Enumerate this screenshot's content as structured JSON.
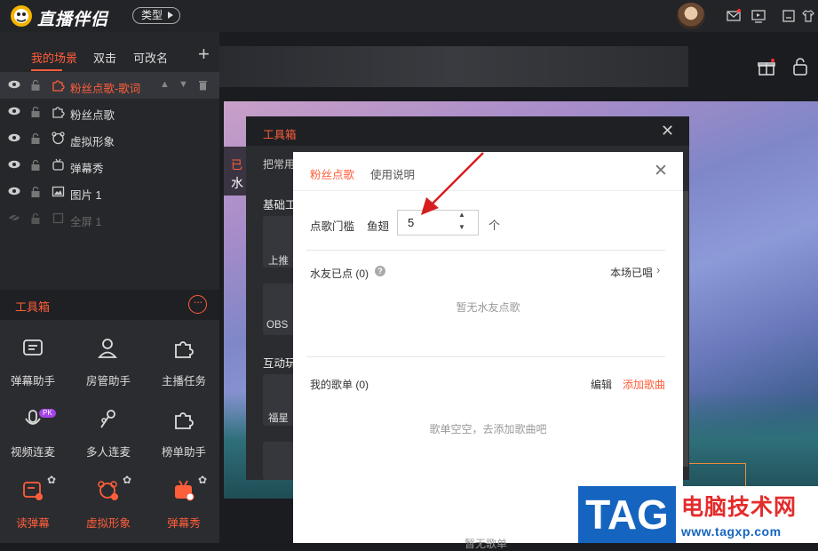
{
  "app": {
    "title": "直播伴侣",
    "type_button": "类型"
  },
  "scene_tabs": [
    {
      "label": "我的场景"
    },
    {
      "label": "双击"
    },
    {
      "label": "可改名"
    }
  ],
  "sources": [
    {
      "label": "粉丝点歌-歌词"
    },
    {
      "label": "粉丝点歌"
    },
    {
      "label": "虚拟形象"
    },
    {
      "label": "弹幕秀"
    },
    {
      "label": "图片 1"
    },
    {
      "label": "全屏 1"
    }
  ],
  "toolbox": {
    "title": "工具箱",
    "more_icon": "more-dots-icon",
    "tools": [
      {
        "label": "弹幕助手",
        "icon": "danmaku-helper-icon"
      },
      {
        "label": "房管助手",
        "icon": "room-admin-icon"
      },
      {
        "label": "主播任务",
        "icon": "puzzle-icon"
      },
      {
        "label": "视频连麦",
        "icon": "mic-icon",
        "badge": "PK"
      },
      {
        "label": "多人连麦",
        "icon": "multi-mic-icon"
      },
      {
        "label": "榜单助手",
        "icon": "puzzle-icon"
      },
      {
        "label": "读弹幕",
        "icon": "read-danmaku-icon"
      },
      {
        "label": "虚拟形象",
        "icon": "avatar-icon"
      },
      {
        "label": "弹幕秀",
        "icon": "tv-icon"
      }
    ]
  },
  "preview_text": {
    "red": "已",
    "white": "水"
  },
  "toolbox_window": {
    "title": "工具箱",
    "tab_partial": "把常用",
    "section_basic": "基础工",
    "section_interactive": "互动玩",
    "cards": [
      {
        "label": "上推"
      },
      {
        "label": "OBS"
      },
      {
        "label": "福星"
      }
    ]
  },
  "dialog": {
    "tabs": [
      {
        "label": "粉丝点歌"
      },
      {
        "label": "使用说明"
      }
    ],
    "threshold_label": "点歌门槛",
    "threshold_unit": "鱼翅",
    "threshold_value": "5",
    "threshold_count_unit": "个",
    "fan_requests_label": "水友已点 (0)",
    "help_mark": "?",
    "sung_link": "本场已唱",
    "fan_empty": "暂无水友点歌",
    "my_list_label": "我的歌单 (0)",
    "edit_label": "编辑",
    "add_song_label": "添加歌曲",
    "list_empty": "歌单空空，去添加歌曲吧",
    "bottom_partial": "暂无歌单"
  },
  "watermark": {
    "tag": "TAG",
    "site_name": "电脑技术网",
    "url": "www.tagxp.com"
  },
  "colors": {
    "accent": "#ff5e3a",
    "panel": "#26272b",
    "watermark_blue": "#1565c0",
    "watermark_red": "#e32c2c"
  }
}
